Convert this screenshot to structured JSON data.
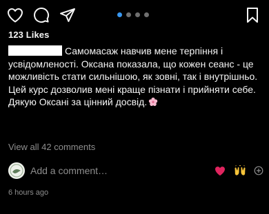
{
  "post": {
    "likes_text": "123 Likes",
    "caption_text": "Самомасаж навчив мене терпіння і усвідомленості. Оксана показала, що кожен сеанс - це можливість стати сильнішою, як зовні, так і внутрішньо. Цей курс дозволив мені краще пізнати і прийняти себе. Дякую Оксані за цінний досвід.",
    "carousel": {
      "count": 4,
      "active_index": 0
    },
    "view_comments_label": "View all 42 comments",
    "add_comment_placeholder": "Add a comment…",
    "timestamp": "6 hours ago"
  },
  "icons": {
    "like": "heart-outline-icon",
    "comment": "comment-bubble-icon",
    "share": "paper-plane-icon",
    "save": "bookmark-icon",
    "quick_heart": "red-heart-emoji",
    "quick_hands": "raising-hands-emoji",
    "plus": "plus-circle-icon",
    "caption_flower": "cherry-blossom-emoji"
  },
  "colors": {
    "background": "#000000",
    "text": "#f5f5f5",
    "muted": "#8e8e8e",
    "active_dot": "#3897f0",
    "inactive_dot": "#6f6f6f",
    "heart_red": "#e0245e"
  }
}
